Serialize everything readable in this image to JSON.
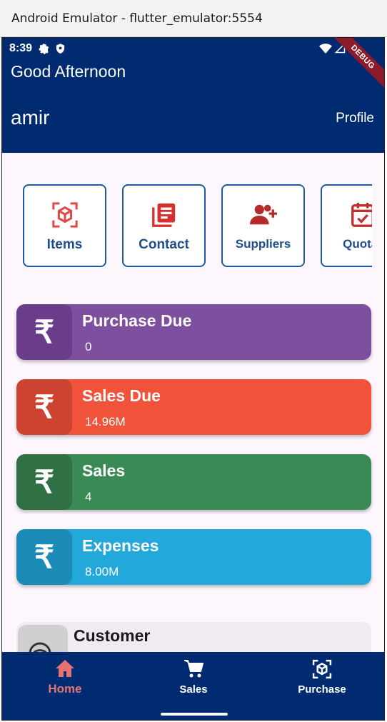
{
  "window": {
    "title": "Android Emulator - flutter_emulator:5554"
  },
  "status_bar": {
    "time": "8:39"
  },
  "debug_banner": "DEBUG",
  "header": {
    "greeting": "Good Afternoon",
    "username": "amir",
    "profile_label": "Profile"
  },
  "quick_actions": [
    {
      "label": "Items",
      "icon": "cube-scan-icon"
    },
    {
      "label": "Contact",
      "icon": "contact-book-icon"
    },
    {
      "label": "Suppliers",
      "icon": "add-user-icon"
    },
    {
      "label": "Quotat",
      "icon": "calendar-check-icon"
    }
  ],
  "stats": [
    {
      "title": "Purchase Due",
      "value": "0",
      "color": "#7e4e9f",
      "icon_bg": "#6a3d8a"
    },
    {
      "title": "Sales Due",
      "value": "14.96M",
      "color": "#f0523a",
      "icon_bg": "#cc4330"
    },
    {
      "title": "Sales",
      "value": "4",
      "color": "#3a8a55",
      "icon_bg": "#2f7045"
    },
    {
      "title": "Expenses",
      "value": "8.00M",
      "color": "#22a8da",
      "icon_bg": "#1c8bb8"
    }
  ],
  "currency_symbol": "₹",
  "customer_section": {
    "title": "Customer"
  },
  "bottom_nav": [
    {
      "label": "Home",
      "icon": "home-icon",
      "active": true
    },
    {
      "label": "Sales",
      "icon": "cart-icon",
      "active": false
    },
    {
      "label": "Purchase",
      "icon": "cube-scan-icon",
      "active": false
    }
  ],
  "colors": {
    "primary": "#012b70",
    "accent_red": "#e04848",
    "nav_active": "#e57373"
  }
}
